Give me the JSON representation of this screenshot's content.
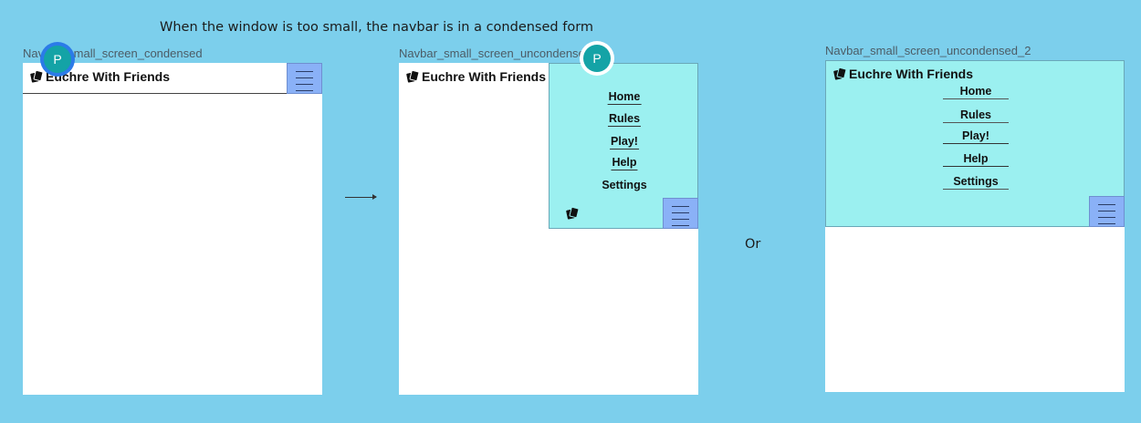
{
  "heading": "When the window is too small, the navbar is in a condensed form",
  "or_text": "Or",
  "frames": {
    "condensed": {
      "label": "Navbar_small_screen_condensed",
      "brand": "Euchre With Friends",
      "avatar": "P"
    },
    "uncondensed": {
      "label": "Navbar_small_screen_uncondensed",
      "brand": "Euchre With Friends",
      "avatar": "P",
      "menu": [
        "Home",
        "Rules",
        "Play!",
        "Help",
        "Settings"
      ]
    },
    "uncondensed_2": {
      "label": "Navbar_small_screen_uncondensed_2",
      "brand": "Euchre With Friends",
      "menu": [
        "Home",
        "Rules",
        "Play!",
        "Help",
        "Settings"
      ]
    }
  },
  "icons": {
    "logo": "cards-logo-icon",
    "menu": "hamburger-menu-icon",
    "arrow": "right-arrow-icon"
  },
  "colors": {
    "canvas": "#7ccfec",
    "menu_panel": "#9bf0f0",
    "hamburger": "#8ab1f7",
    "avatar": "#14a3a6"
  }
}
